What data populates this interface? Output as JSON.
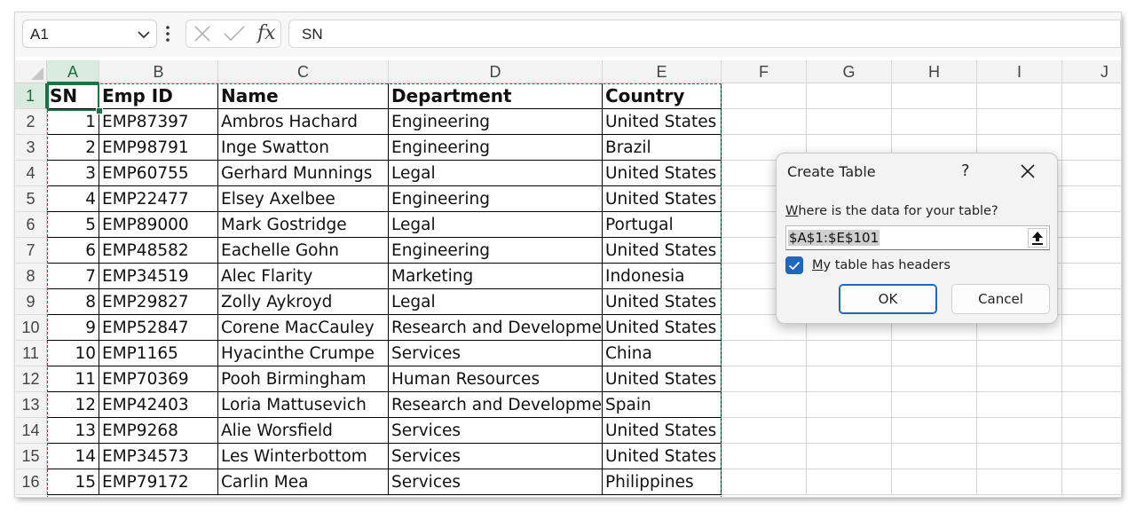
{
  "formula_bar": {
    "name_box": "A1",
    "formula": "SN",
    "fx_label": "fx",
    "icons": [
      "chevron-down-icon",
      "more-vertical-icon",
      "cancel-x-icon",
      "enter-check-icon"
    ]
  },
  "columns": [
    "A",
    "B",
    "C",
    "D",
    "E",
    "F",
    "G",
    "H",
    "I",
    "J"
  ],
  "rows": [
    "1",
    "2",
    "3",
    "4",
    "5",
    "6",
    "7",
    "8",
    "9",
    "10",
    "11",
    "12",
    "13",
    "14",
    "15",
    "16"
  ],
  "table": {
    "headers": [
      "SN",
      "Emp ID",
      "Name",
      "Department",
      "Country"
    ],
    "rows": [
      [
        "1",
        "EMP87397",
        "Ambros Hachard",
        "Engineering",
        "United States"
      ],
      [
        "2",
        "EMP98791",
        "Inge Swatton",
        "Engineering",
        "Brazil"
      ],
      [
        "3",
        "EMP60755",
        "Gerhard Munnings",
        "Legal",
        "United States"
      ],
      [
        "4",
        "EMP22477",
        "Elsey Axelbee",
        "Engineering",
        "United States"
      ],
      [
        "5",
        "EMP89000",
        "Mark Gostridge",
        "Legal",
        "Portugal"
      ],
      [
        "6",
        "EMP48582",
        "Eachelle Gohn",
        "Engineering",
        "United States"
      ],
      [
        "7",
        "EMP34519",
        "Alec Flarity",
        "Marketing",
        "Indonesia"
      ],
      [
        "8",
        "EMP29827",
        "Zolly Aykroyd",
        "Legal",
        "United States"
      ],
      [
        "9",
        "EMP52847",
        "Corene MacCauley",
        "Research and Development",
        "United States"
      ],
      [
        "10",
        "EMP1165",
        "Hyacinthe Crumpe",
        "Services",
        "China"
      ],
      [
        "11",
        "EMP70369",
        "Pooh Birmingham",
        "Human Resources",
        "United States"
      ],
      [
        "12",
        "EMP42403",
        "Loria Mattusevich",
        "Research and Development",
        "Spain"
      ],
      [
        "13",
        "EMP9268",
        "Alie Worsfield",
        "Services",
        "United States"
      ],
      [
        "14",
        "EMP34573",
        "Les Winterbottom",
        "Services",
        "United States"
      ],
      [
        "15",
        "EMP79172",
        "Carlin Mea",
        "Services",
        "Philippines"
      ]
    ]
  },
  "dialog": {
    "title": "Create Table",
    "help": "?",
    "prompt_first": "W",
    "prompt_rest": "here is the data for your table?",
    "range_value": "$A$1:$E$101",
    "checkbox_first": "M",
    "checkbox_rest": "y table has headers",
    "checkbox_checked": true,
    "ok_label": "OK",
    "cancel_label": "Cancel"
  },
  "colors": {
    "accent_green": "#1e7145",
    "dialog_blue": "#1f66c1"
  }
}
